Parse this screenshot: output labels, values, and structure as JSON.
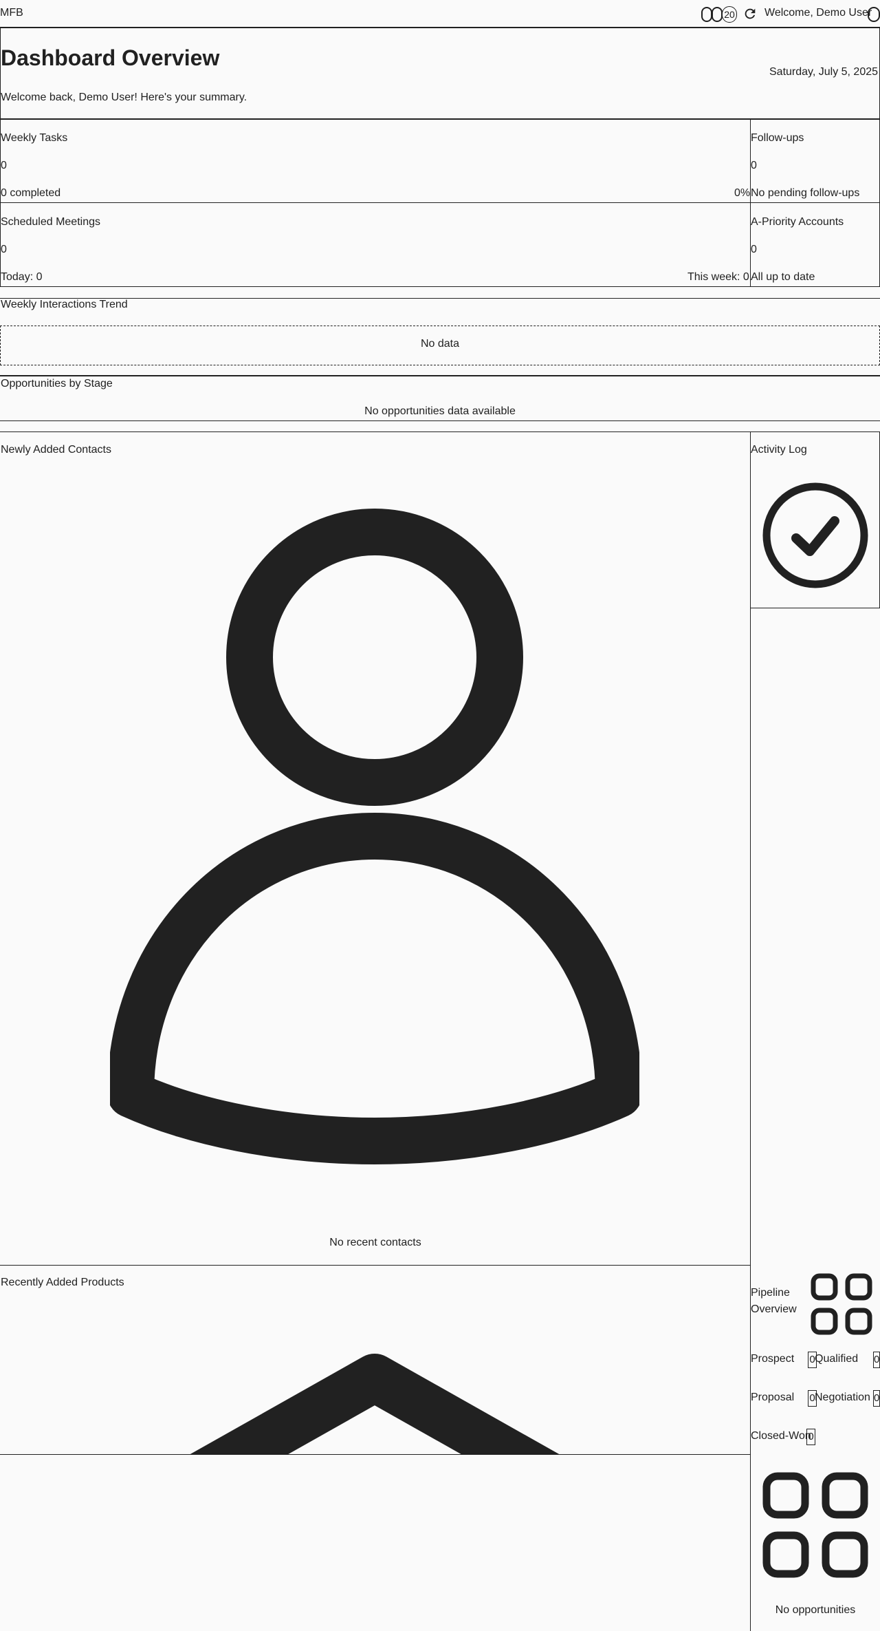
{
  "topbar": {
    "brand": "MFB",
    "notification_count": "20",
    "welcome": "Welcome, Demo User",
    "icons": [
      "circle-outline-icon",
      "circle-outline-icon",
      "notification-icon",
      "refresh-icon",
      "avatar-icon"
    ]
  },
  "header": {
    "title": "Dashboard Overview",
    "date": "Saturday, July 5, 2025",
    "subtitle": "Welcome back, Demo User! Here's your summary."
  },
  "stats": {
    "weekly_tasks": {
      "title": "Weekly Tasks",
      "value": "0",
      "completed": "0 completed",
      "percent": "0%"
    },
    "follow_ups": {
      "title": "Follow-ups",
      "value": "0",
      "note": "No pending follow-ups"
    },
    "meetings": {
      "title": "Scheduled Meetings",
      "value": "0",
      "today": "Today: 0",
      "week": "This week: 0"
    },
    "a_priority": {
      "title": "A-Priority Accounts",
      "value": "0",
      "note": "All up to date"
    }
  },
  "trend": {
    "title": "Weekly Interactions Trend",
    "empty": "No data"
  },
  "opportunities": {
    "title": "Opportunities by Stage",
    "empty": "No opportunities data available"
  },
  "contacts": {
    "title": "Newly Added Contacts",
    "empty": "No recent contacts",
    "icon": "person-icon"
  },
  "activity": {
    "title": "Activity Log",
    "icon": "check-circle-icon"
  },
  "products": {
    "title": "Recently Added Products",
    "icon": "chevron-up-icon"
  },
  "pipeline": {
    "title_line1": "Pipeline",
    "title_line2": "Overview",
    "icon": "grid-icon",
    "stages": [
      {
        "label": "Prospect",
        "count": "0"
      },
      {
        "label": "Qualified",
        "count": "0"
      },
      {
        "label": "Proposal",
        "count": "0"
      },
      {
        "label": "Negotiation",
        "count": "0"
      },
      {
        "label": "Closed-Won",
        "count": "0"
      }
    ],
    "empty": "No opportunities"
  }
}
